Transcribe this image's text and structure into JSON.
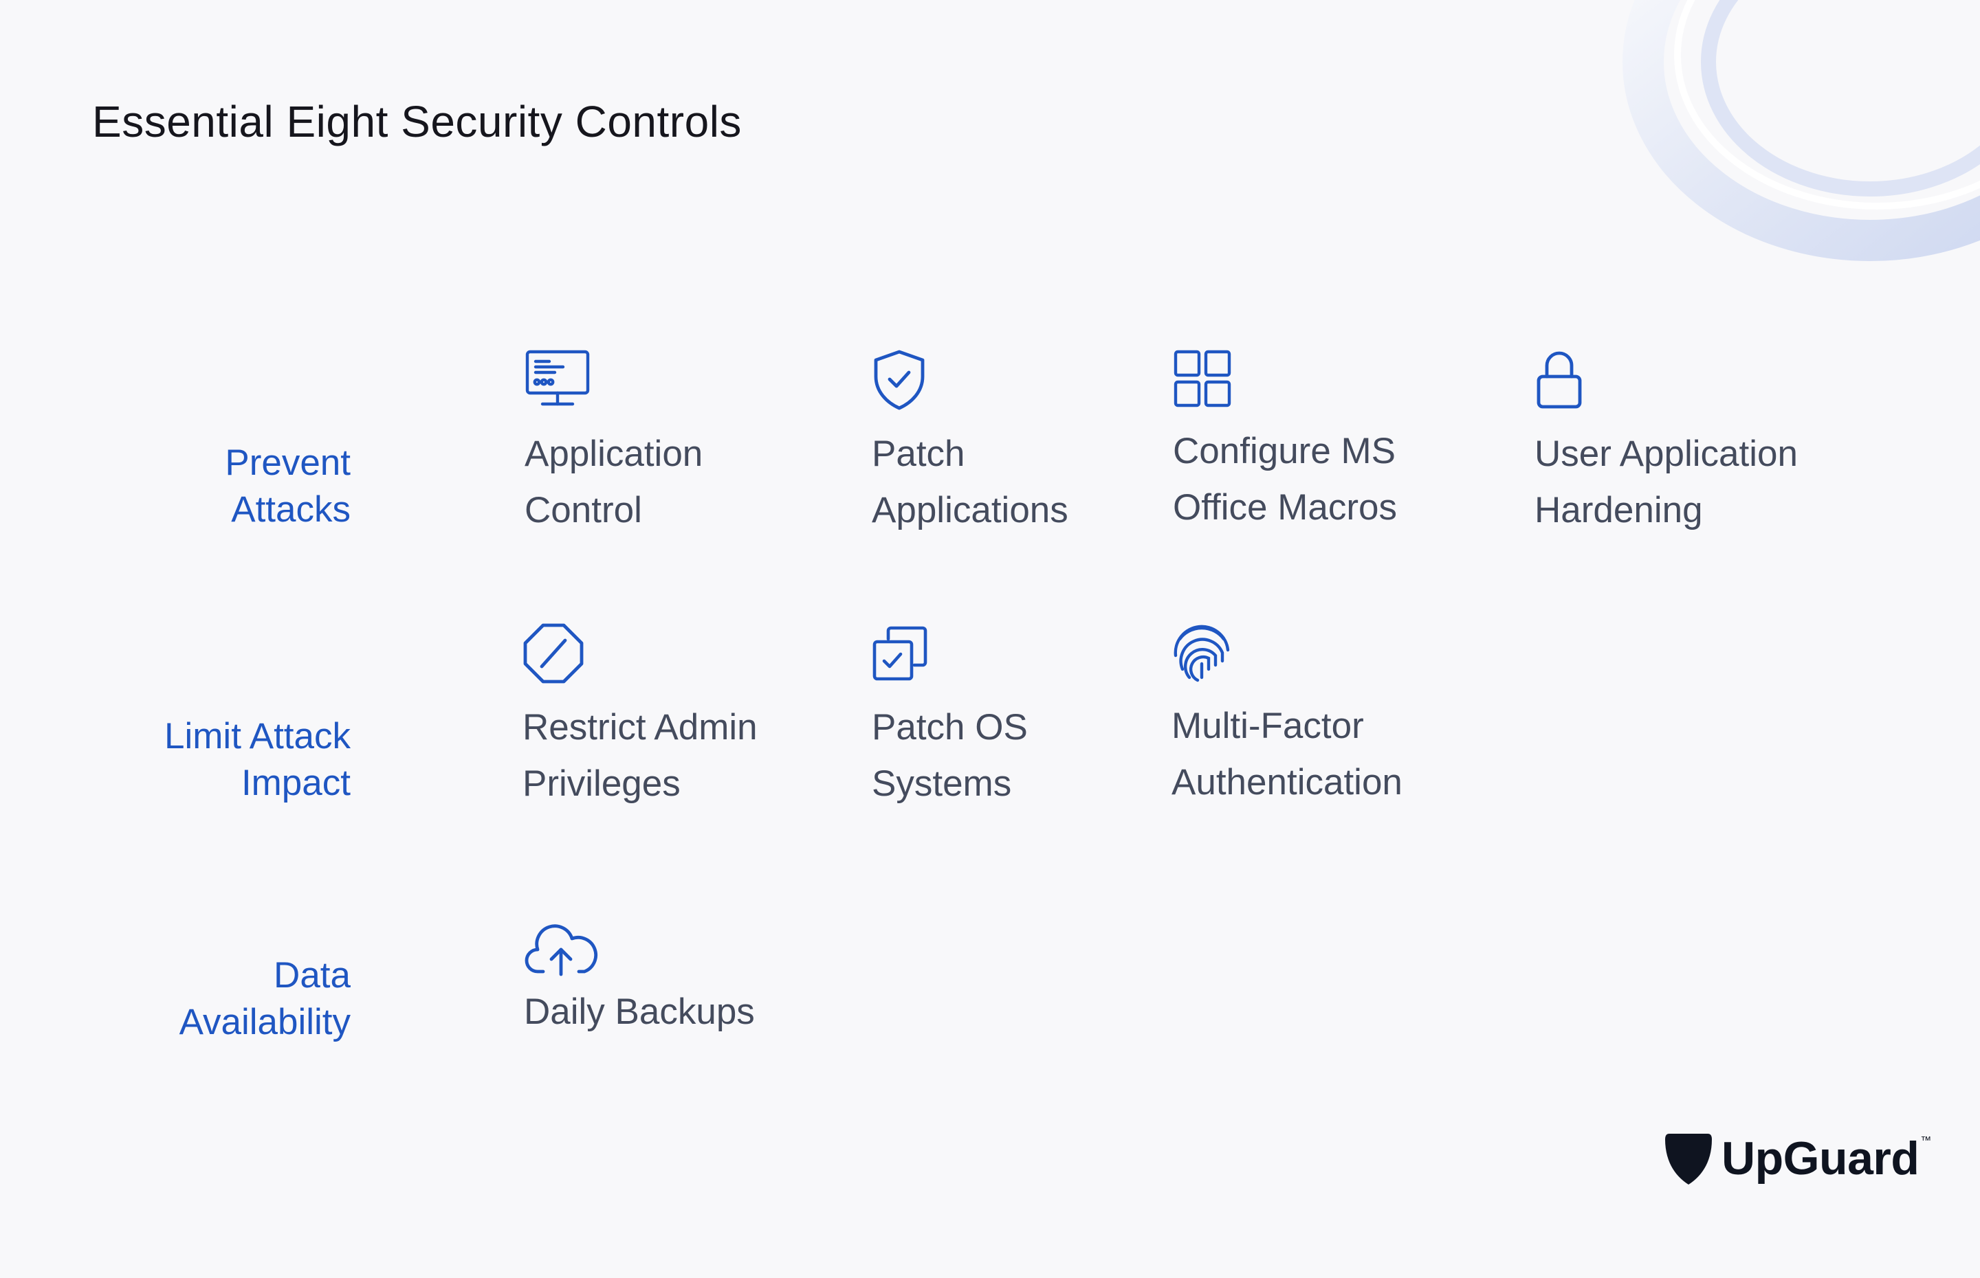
{
  "header": {
    "title": "Essential Eight Security Controls"
  },
  "accent": "#1f56c2",
  "groups": [
    {
      "lines": [
        "Prevent",
        "Attacks"
      ],
      "controls": [
        {
          "icon": "monitor-icon",
          "lines": [
            "Application",
            "Control"
          ]
        },
        {
          "icon": "shield-check-icon",
          "lines": [
            "Patch",
            "Applications"
          ]
        },
        {
          "icon": "grid-icon",
          "lines": [
            "Configure MS",
            "Office Macros"
          ]
        },
        {
          "icon": "lock-icon",
          "lines": [
            "User Application",
            "Hardening"
          ]
        }
      ]
    },
    {
      "lines": [
        "Limit Attack",
        "Impact"
      ],
      "controls": [
        {
          "icon": "prohibited-icon",
          "lines": [
            "Restrict Admin",
            "Privileges"
          ]
        },
        {
          "icon": "copy-check-icon",
          "lines": [
            "Patch OS",
            "Systems"
          ]
        },
        {
          "icon": "fingerprint-icon",
          "lines": [
            "Multi-Factor",
            "Authentication"
          ]
        }
      ]
    },
    {
      "lines": [
        "Data",
        "Availability"
      ],
      "controls": [
        {
          "icon": "cloud-upload-icon",
          "lines": [
            "Daily Backups"
          ]
        }
      ]
    }
  ],
  "logo": {
    "name": "UpGuard",
    "tm": "™"
  }
}
